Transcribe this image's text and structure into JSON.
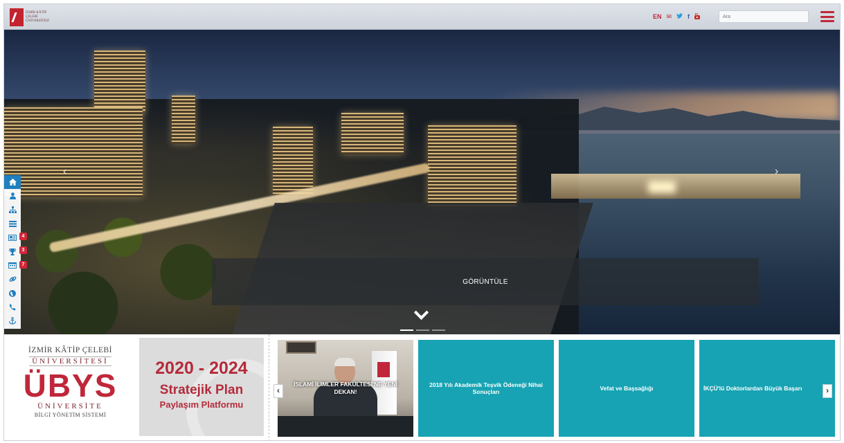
{
  "header": {
    "logo_text": "İZMİR KÂTİP ÇELEBİ ÜNİVERSİTESİ",
    "lang": "EN",
    "social": {
      "mail": "✉",
      "twitter": "🐦",
      "facebook": "f",
      "youtube": "▶"
    },
    "search_placeholder": "Ara"
  },
  "hero": {
    "caption": "GÖRÜNTÜLE",
    "left_arrow": "‹",
    "right_arrow": "›",
    "dot_count": 3
  },
  "sidebar_nav": {
    "items": [
      {
        "icon": "home-icon",
        "glyph": "⌂"
      },
      {
        "icon": "user-icon",
        "glyph": "👤"
      },
      {
        "icon": "org-chart-icon",
        "glyph": "⊞"
      },
      {
        "icon": "list-icon",
        "glyph": "☰"
      },
      {
        "icon": "news-icon",
        "glyph": "▤",
        "badge": "4"
      },
      {
        "icon": "trophy-icon",
        "glyph": "🏆",
        "badge": "3"
      },
      {
        "icon": "calendar-icon",
        "glyph": "▦",
        "badge": "7"
      },
      {
        "icon": "link-icon",
        "glyph": "🔗"
      },
      {
        "icon": "globe-icon",
        "glyph": "●"
      },
      {
        "icon": "phone-icon",
        "glyph": "☎"
      },
      {
        "icon": "anchor-icon",
        "glyph": "⚓"
      }
    ]
  },
  "ubys": {
    "line1": "İZMİR KÂTİP ÇELEBİ",
    "line2": "ÜNİVERSİTESİ",
    "big": "ÜBYS",
    "line3": "ÜNİVERSİTE",
    "line4": "BİLGİ YÖNETİM SİSTEMİ"
  },
  "plan": {
    "years": "2020 - 2024",
    "title": "Stratejik Plan",
    "subtitle": "Paylaşım Platformu"
  },
  "news": {
    "prev": "‹",
    "next": "›",
    "cards": [
      {
        "title": "İSLAMİ İLİMLER FAKÜLTESİ'NE YENİ DEKAN!"
      },
      {
        "title": "2018 Yılı Akademik Teşvik Ödeneği Nihai Sonuçları"
      },
      {
        "title": "Vefat ve Başsağlığı"
      },
      {
        "title": "İKÇÜ'lü Doktorlardan Büyük Başarı"
      }
    ]
  },
  "colors": {
    "brand_red": "#c0273a",
    "teal": "#17a3b3",
    "nav_blue": "#1f7fbf"
  }
}
